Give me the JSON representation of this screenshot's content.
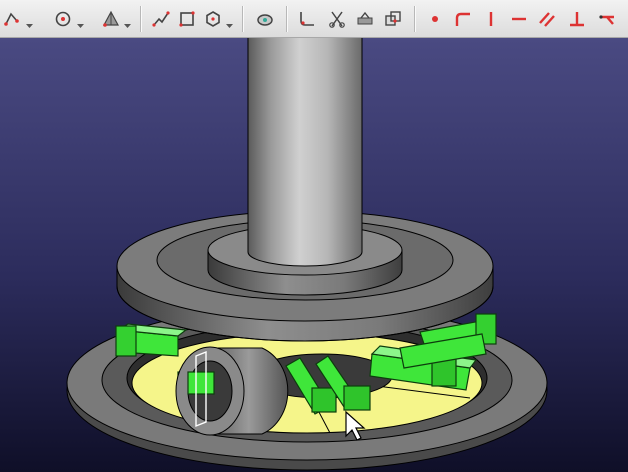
{
  "toolbar": {
    "buttons": [
      {
        "name": "sketch-tool-button",
        "icon": "sketch-icon"
      },
      {
        "name": "circle-tool-button",
        "icon": "circle-target-icon"
      },
      {
        "name": "pyramid-tool-button",
        "icon": "pyramid-icon"
      },
      {
        "name": "polyline-tool-button",
        "icon": "polyline-icon"
      },
      {
        "name": "rectangle-tool-button",
        "icon": "rectangle-icon"
      },
      {
        "name": "hexagon-tool-button",
        "icon": "hexagon-icon"
      },
      {
        "name": "external-geometry-button",
        "icon": "external-geometry-icon"
      },
      {
        "name": "fillet-tool-button",
        "icon": "fillet-icon"
      },
      {
        "name": "trim-tool-button",
        "icon": "scissors-icon"
      },
      {
        "name": "construction-mode-button",
        "icon": "construction-icon"
      },
      {
        "name": "clone-tool-button",
        "icon": "clone-icon"
      },
      {
        "name": "point-constraint-button",
        "icon": "point-icon"
      },
      {
        "name": "tangent-constraint-button",
        "icon": "tangent-icon"
      },
      {
        "name": "vertical-constraint-button",
        "icon": "vertical-icon"
      },
      {
        "name": "horizontal-constraint-button",
        "icon": "horizontal-icon"
      },
      {
        "name": "parallel-constraint-button",
        "icon": "parallel-icon"
      },
      {
        "name": "perpendicular-constraint-button",
        "icon": "perpendicular-icon"
      },
      {
        "name": "symmetric-constraint-button",
        "icon": "symmetric-icon"
      }
    ]
  },
  "colors": {
    "toolbar_bg": "#e6e6e6",
    "viewport_top": "#47477d",
    "viewport_bottom": "#0f0f28",
    "model_grey": "#6f6f6f",
    "model_highlight": "#bcbcbc",
    "selection_green": "#3fe63a",
    "face_yellow": "#f5f58a",
    "edge_black": "#000000"
  }
}
